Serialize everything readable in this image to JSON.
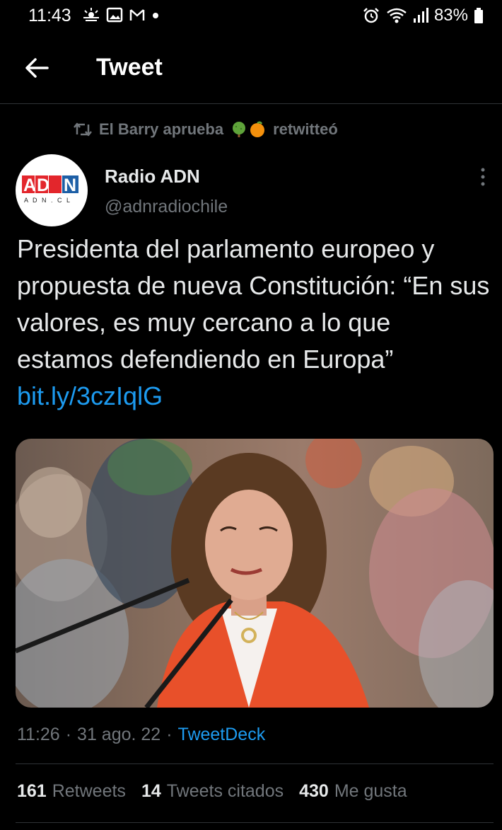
{
  "status_bar": {
    "time": "11:43",
    "battery": "83%",
    "icons_left": [
      "weather-icon",
      "image-icon",
      "gmail-icon",
      "dot-icon"
    ],
    "icons_right": [
      "alarm-icon",
      "wifi-icon",
      "signal-icon",
      "battery-icon"
    ]
  },
  "header": {
    "title": "Tweet"
  },
  "retweet": {
    "user": "El Barry aprueba",
    "suffix": "retwitteó",
    "emojis": [
      "tree-emoji",
      "orange-emoji"
    ]
  },
  "author": {
    "name": "Radio ADN",
    "handle": "@adnradiochile",
    "avatar_text": "ADN",
    "avatar_subtext": "A D N . C L"
  },
  "tweet": {
    "text": "Presidenta del parlamento europeo y propuesta de nueva Constitución: “En sus valores, es muy cercano a lo que estamos defendiendo en Europa”",
    "link": "bit.ly/3czIqlG"
  },
  "meta": {
    "time": "11:26",
    "sep1": "·",
    "date": "31 ago. 22",
    "sep2": "·",
    "source": "TweetDeck"
  },
  "stats": [
    {
      "count": "161",
      "label": "Retweets"
    },
    {
      "count": "14",
      "label": "Tweets citados"
    },
    {
      "count": "430",
      "label": "Me gusta"
    }
  ],
  "colors": {
    "background": "#000000",
    "text": "#e7e9ea",
    "secondary": "#71767b",
    "link": "#1d9bf0",
    "divider": "#2f3336",
    "jacket": "#e8502a"
  }
}
